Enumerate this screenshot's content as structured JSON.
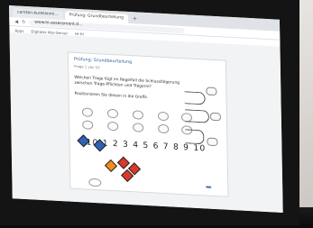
{
  "browser": {
    "tabs": [
      {
        "label": "carsten-kuretanmi..."
      },
      {
        "label": "Prüfung: Grundbeurteilung"
      }
    ],
    "new_tab": "+",
    "url": "www.hi-assessment.d...",
    "bookmarks": [
      "Apps",
      "Digitaler Abo-Server",
      "Hi-Hi"
    ]
  },
  "quiz": {
    "title": "Prüfung: Grundbeurteilung",
    "subtitle": "Frage 1 von 10",
    "question": "Welchen Trage fügt im Regelfall die Schlussfolgerung zwischen Trage-Pflichten und Trägerin?",
    "instruction": "Positionieren Sie diesen in die Grafik.",
    "scale_numbers": "10 1 2 3 4 5 6 7 8 9 10",
    "submit_label": "",
    "next_label": ""
  },
  "colors": {
    "accent": "#3a6db0",
    "diamond_red": "#d8392b",
    "diamond_orange": "#f08c1e",
    "diamond_blue": "#2f62b7"
  }
}
